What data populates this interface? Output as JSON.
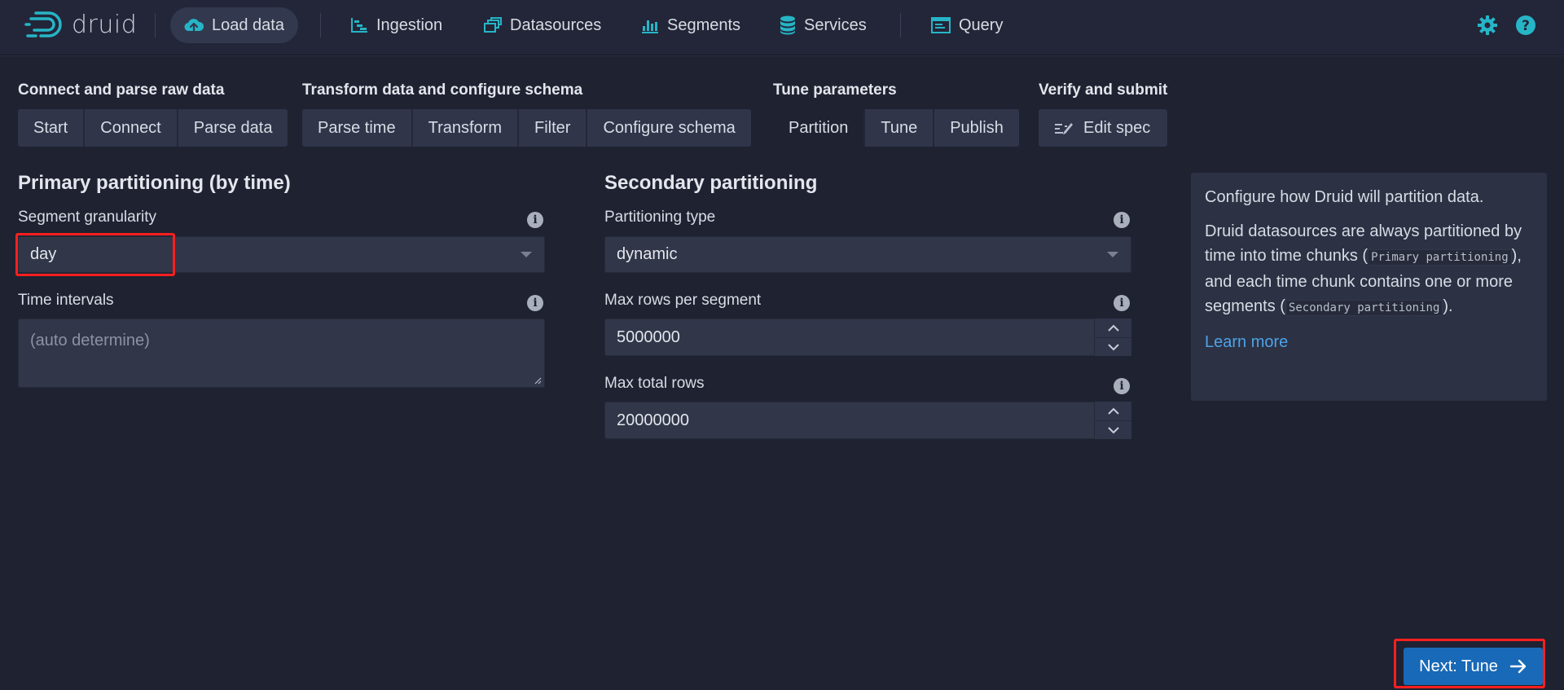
{
  "header": {
    "logo_text": "druid",
    "nav": [
      {
        "label": "Load data",
        "icon": "cloud-upload-icon",
        "active": true
      },
      {
        "label": "Ingestion",
        "icon": "gantt-chart-icon"
      },
      {
        "label": "Datasources",
        "icon": "multi-select-icon"
      },
      {
        "label": "Segments",
        "icon": "stacked-chart-icon"
      },
      {
        "label": "Services",
        "icon": "database-icon"
      },
      {
        "label": "Query",
        "icon": "application-icon"
      }
    ],
    "right_icons": [
      "gear-icon",
      "help-icon"
    ]
  },
  "steps": [
    {
      "title": "Connect and parse raw data",
      "buttons": [
        "Start",
        "Connect",
        "Parse data"
      ]
    },
    {
      "title": "Transform data and configure schema",
      "buttons": [
        "Parse time",
        "Transform",
        "Filter",
        "Configure schema"
      ]
    },
    {
      "title": "Tune parameters",
      "buttons": [
        "Partition",
        "Tune",
        "Publish"
      ],
      "current": "Partition"
    },
    {
      "title": "Verify and submit",
      "buttons": [
        "Edit spec"
      ]
    }
  ],
  "primary": {
    "title": "Primary partitioning (by time)",
    "segment_granularity_label": "Segment granularity",
    "segment_granularity_value": "day",
    "time_intervals_label": "Time intervals",
    "time_intervals_placeholder": "(auto determine)"
  },
  "secondary": {
    "title": "Secondary partitioning",
    "partitioning_type_label": "Partitioning type",
    "partitioning_type_value": "dynamic",
    "max_rows_per_segment_label": "Max rows per segment",
    "max_rows_per_segment_value": "5000000",
    "max_total_rows_label": "Max total rows",
    "max_total_rows_value": "20000000"
  },
  "info_panel": {
    "line1": "Configure how Druid will partition data.",
    "line2_a": "Druid datasources are always partitioned by time into time chunks (",
    "code1": "Primary partitioning",
    "line2_b": "), and each time chunk contains one or more segments (",
    "code2": "Secondary partitioning",
    "line2_c": ").",
    "learn_more": "Learn more"
  },
  "next_button": {
    "label": "Next: Tune",
    "icon": "arrow-right-icon"
  },
  "colors": {
    "background": "#1f2231",
    "accent": "#1869b7",
    "brand_teal": "#19b3c3",
    "highlight": "#ff1f1f"
  }
}
